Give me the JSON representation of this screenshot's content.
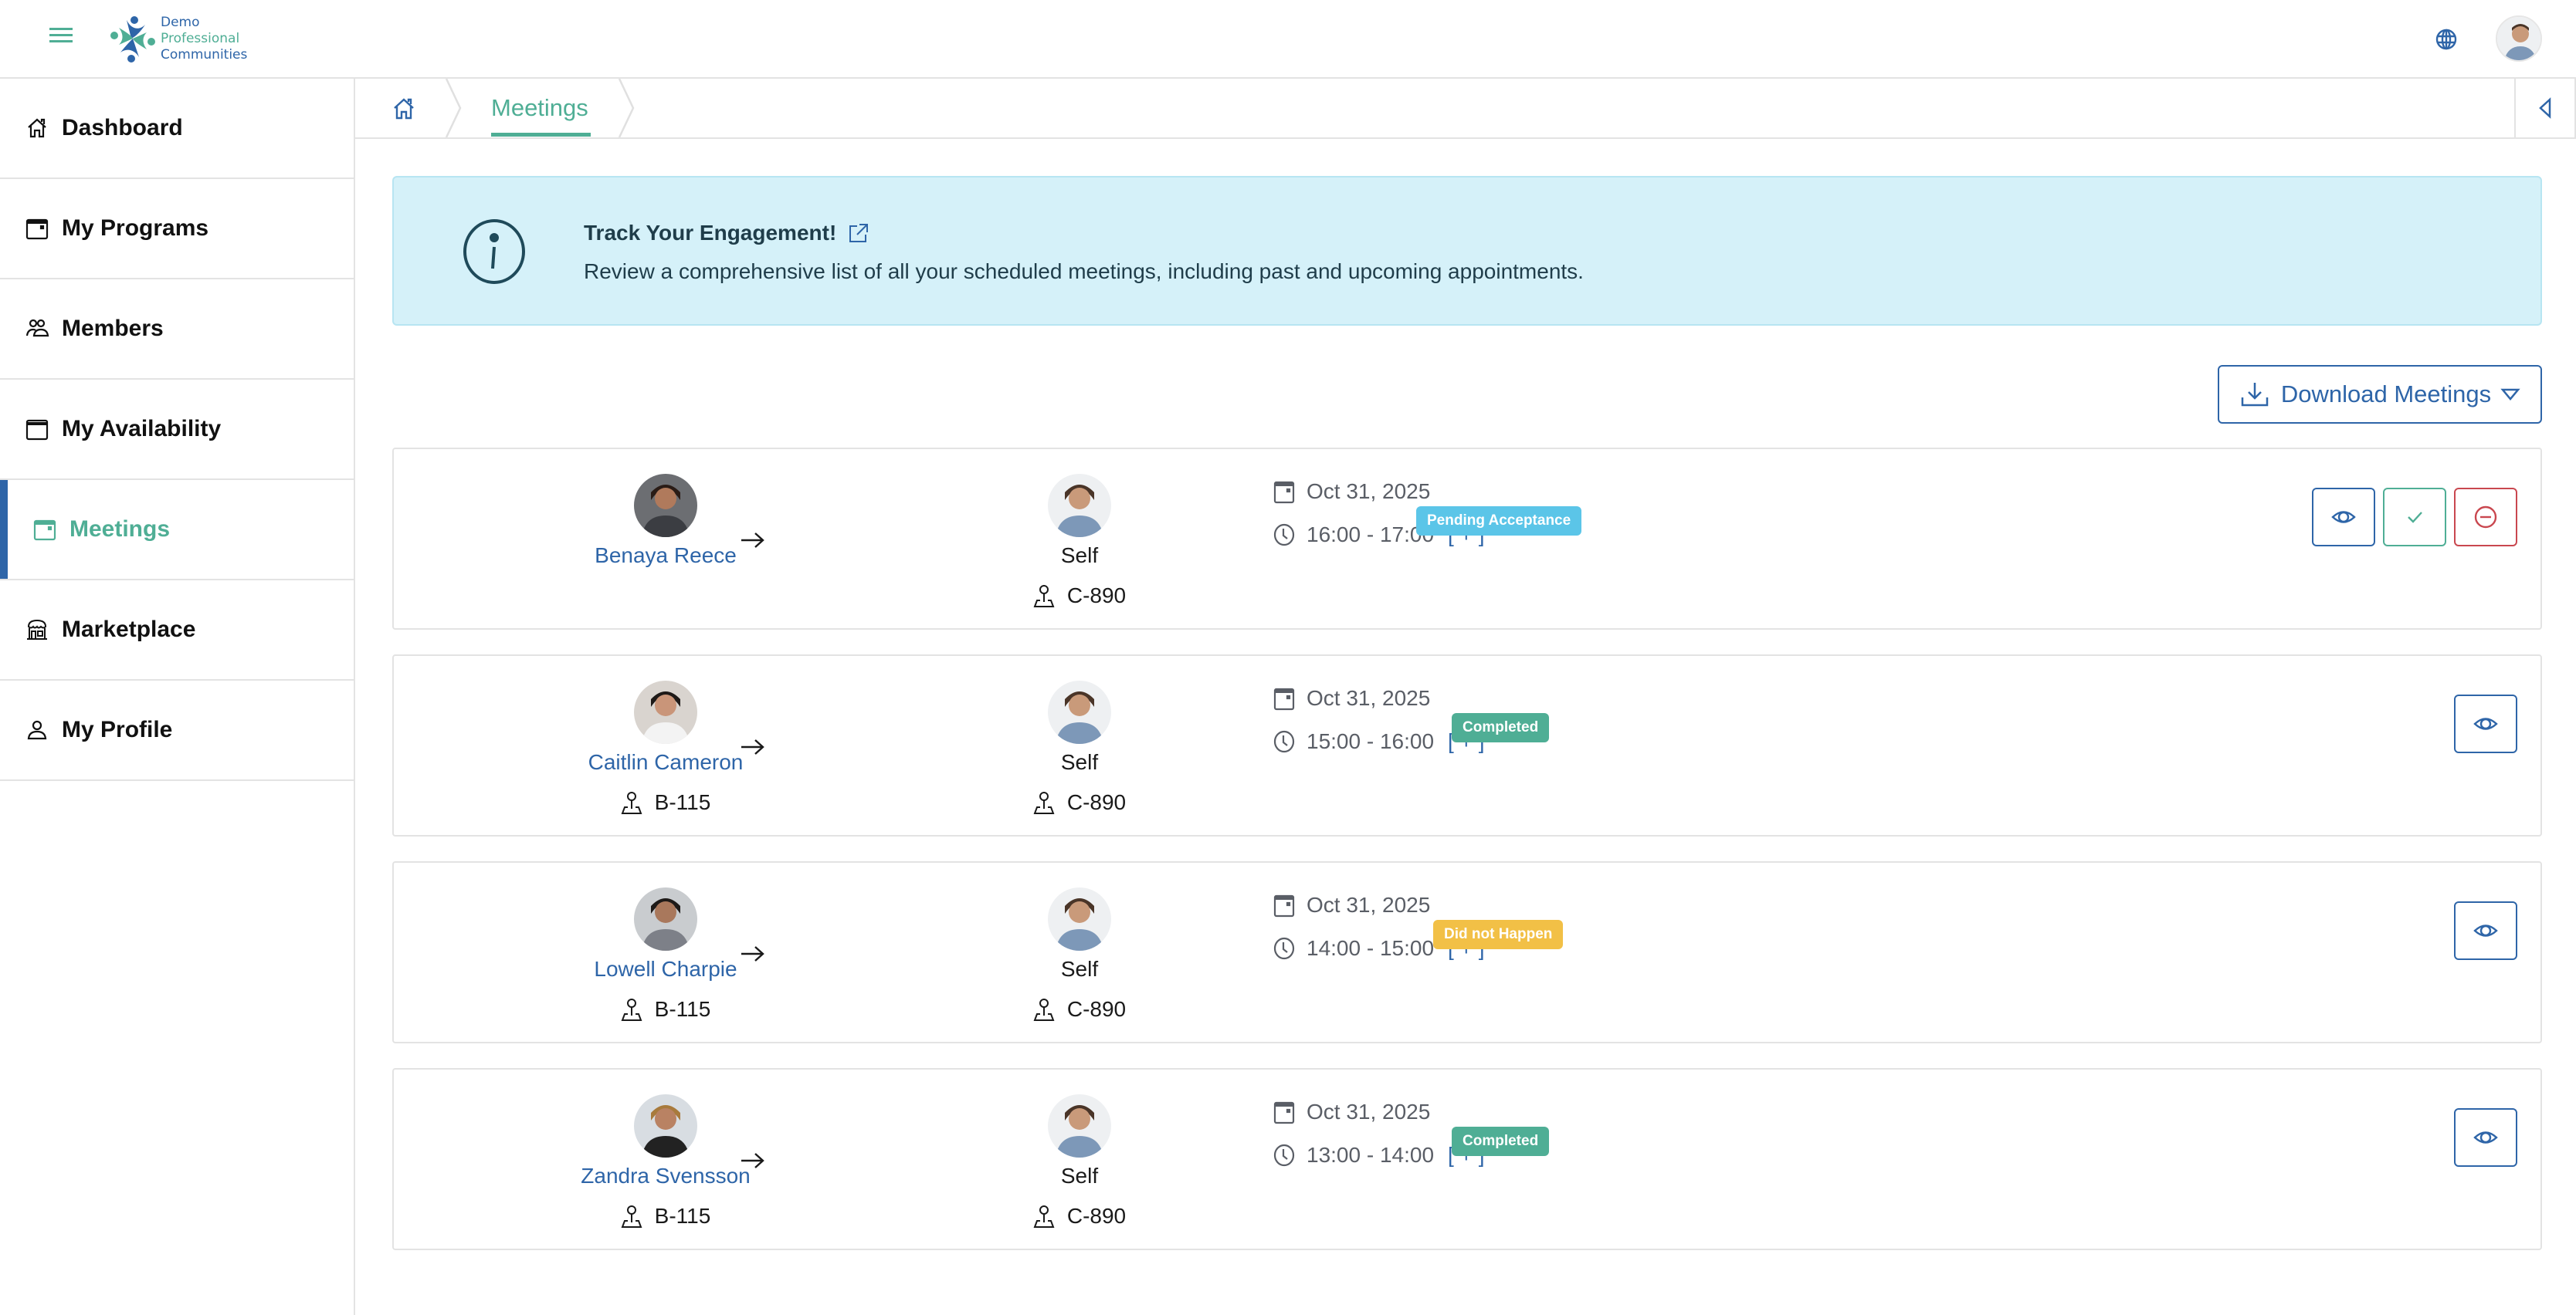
{
  "header": {
    "logo": {
      "line1": "Demo",
      "line2": "Professional",
      "line3": "Communities"
    },
    "icons": {
      "menu": "hamburger-icon",
      "language": "globe-icon",
      "avatar": "user-avatar"
    }
  },
  "sidebar": {
    "items": [
      {
        "label": "Dashboard",
        "icon": "home-icon",
        "active": false
      },
      {
        "label": "My Programs",
        "icon": "calendar-icon",
        "active": false
      },
      {
        "label": "Members",
        "icon": "users-icon",
        "active": false
      },
      {
        "label": "My Availability",
        "icon": "calendar-blank-icon",
        "active": false
      },
      {
        "label": "Meetings",
        "icon": "calendar-icon",
        "active": true
      },
      {
        "label": "Marketplace",
        "icon": "store-icon",
        "active": false
      },
      {
        "label": "My Profile",
        "icon": "user-icon",
        "active": false
      }
    ]
  },
  "breadcrumb": {
    "home_icon": "home-icon",
    "current": "Meetings"
  },
  "banner": {
    "title": "Track Your Engagement!",
    "text": "Review a comprehensive list of all your scheduled meetings, including past and upcoming appointments."
  },
  "download": {
    "label": "Download Meetings"
  },
  "colors": {
    "primary": "#2e65a8",
    "accent": "#4fae95",
    "danger": "#c9474f",
    "banner_bg": "#d5f1f9",
    "status_pending": "#5bc5e8",
    "status_completed": "#4fae95",
    "status_missed": "#f2c046"
  },
  "meetings": [
    {
      "from_name": "Benaya Reece",
      "from_room": "",
      "to_name": "Self",
      "to_room": "C-890",
      "date": "Oct 31, 2025",
      "time": "16:00 - 17:00",
      "more": "[ + ]",
      "status": "Pending Acceptance",
      "status_color": "#5bc5e8",
      "actions": [
        "view",
        "accept",
        "decline"
      ]
    },
    {
      "from_name": "Caitlin Cameron",
      "from_room": "B-115",
      "to_name": "Self",
      "to_room": "C-890",
      "date": "Oct 31, 2025",
      "time": "15:00 - 16:00",
      "more": "[ + ]",
      "status": "Completed",
      "status_color": "#4fae95",
      "actions": [
        "view"
      ]
    },
    {
      "from_name": "Lowell Charpie",
      "from_room": "B-115",
      "to_name": "Self",
      "to_room": "C-890",
      "date": "Oct 31, 2025",
      "time": "14:00 - 15:00",
      "more": "[ + ]",
      "status": "Did not Happen",
      "status_color": "#f2c046",
      "actions": [
        "view"
      ]
    },
    {
      "from_name": "Zandra Svensson",
      "from_room": "B-115",
      "to_name": "Self",
      "to_room": "C-890",
      "date": "Oct 31, 2025",
      "time": "13:00 - 14:00",
      "more": "[ + ]",
      "status": "Completed",
      "status_color": "#4fae95",
      "actions": [
        "view"
      ]
    }
  ]
}
